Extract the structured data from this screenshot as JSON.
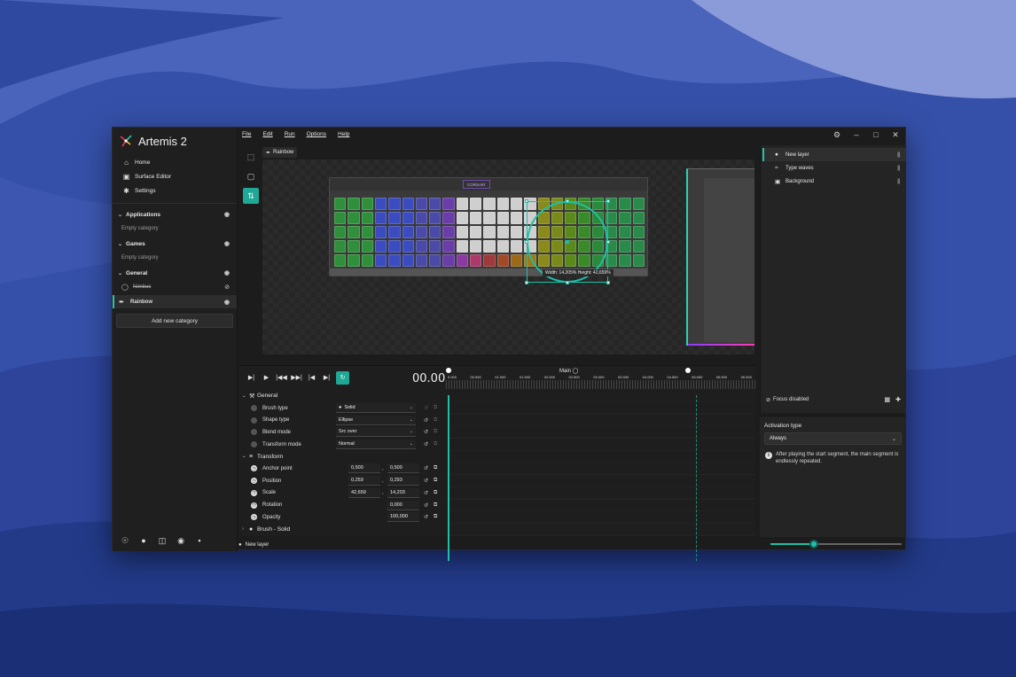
{
  "app": {
    "title": "Artemis 2"
  },
  "menubar": [
    "File",
    "Edit",
    "Run",
    "Options",
    "Help"
  ],
  "nav": [
    {
      "label": "Home",
      "icon": "home-icon"
    },
    {
      "label": "Surface Editor",
      "icon": "surface-editor-icon"
    },
    {
      "label": "Settings",
      "icon": "gear-icon"
    }
  ],
  "categories": {
    "applications": {
      "label": "Applications",
      "empty": "Empty category"
    },
    "games": {
      "label": "Games",
      "empty": "Empty category"
    },
    "general": {
      "label": "General"
    }
  },
  "profiles": {
    "disabled": {
      "label": "Nimbus"
    },
    "rainbow": {
      "label": "Rainbow"
    }
  },
  "add_category": "Add new category",
  "canvas": {
    "profile_chip": "Rainbow",
    "device_brand": "CORSAIR",
    "size_label": "Width: 14,205% Height: 42,659%"
  },
  "layers": [
    {
      "label": "New layer",
      "icon": "drop-icon"
    },
    {
      "label": "Type waves",
      "icon": "waves-icon"
    },
    {
      "label": "Background",
      "icon": "image-icon"
    }
  ],
  "focus": {
    "label": "Focus disabled"
  },
  "activation": {
    "title": "Activation type",
    "value": "Always",
    "info": "After playing the start segment, the main segment is endlessly repeated."
  },
  "zoom": {
    "value": 0.33
  },
  "timeline": {
    "time": "00.000",
    "segment": "Main",
    "ruler": [
      "0.000",
      "00.500",
      "01.000",
      "01.500",
      "02.000",
      "02.500",
      "03.000",
      "03.500",
      "04.000",
      "04.500",
      "05.000",
      "05.500",
      "06.000"
    ]
  },
  "properties": {
    "general": {
      "label": "General",
      "brush_type": {
        "label": "Brush type",
        "value": "Solid"
      },
      "shape_type": {
        "label": "Shape type",
        "value": "Ellipse"
      },
      "blend_mode": {
        "label": "Blend mode",
        "value": "Src over"
      },
      "transform_mode": {
        "label": "Transform mode",
        "value": "Normal"
      }
    },
    "transform": {
      "label": "Transform",
      "anchor_point": {
        "label": "Anchor point",
        "x": "0,500",
        "y": "0,500"
      },
      "position": {
        "label": "Position",
        "x": "0,259",
        "y": "0,293"
      },
      "scale": {
        "label": "Scale",
        "x": "42,659",
        "y": "14,203"
      },
      "rotation": {
        "label": "Rotation",
        "value": "0,000"
      },
      "opacity": {
        "label": "Opacity",
        "value": "100,000"
      }
    },
    "brush": {
      "label": "Brush - Solid"
    }
  },
  "status": {
    "layer": "New layer"
  },
  "colors": {
    "accent": "#1fbfa6",
    "window": "#1c1c1c",
    "wallpaper": "#2a3f8f"
  }
}
